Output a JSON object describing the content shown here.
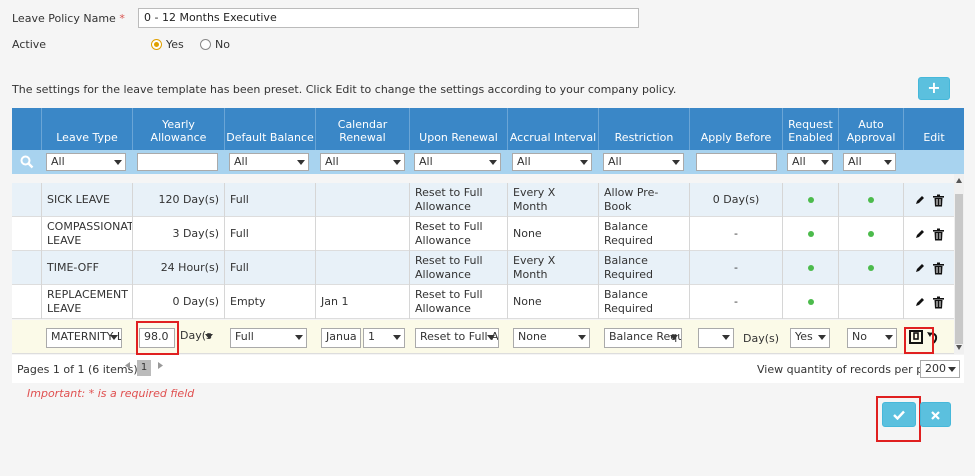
{
  "form": {
    "policy_name_label": "Leave Policy Name",
    "required_mark": "*",
    "policy_name_value": "0 - 12 Months Executive",
    "active_label": "Active",
    "active_yes": "Yes",
    "active_no": "No"
  },
  "notice": "The settings for the leave template has been preset. Click Edit to change the settings according to your company policy.",
  "add_button": "+",
  "table": {
    "headers": [
      "Leave Type",
      "Yearly Allowance",
      "Default Balance",
      "Calendar Renewal",
      "Upon Renewal",
      "Accrual Interval",
      "Restriction",
      "Apply Before",
      "Request Enabled",
      "Auto Approval",
      "Edit"
    ],
    "filter_all": "All",
    "rows": [
      {
        "type": "SICK LEAVE",
        "allowance": "120 Day(s)",
        "balance": "Full",
        "calendar": "",
        "renewal": "Reset to Full Allowance",
        "accrual": "Every X Month",
        "restriction": "Allow Pre-Book",
        "apply_before": "0 Day(s)",
        "request": true,
        "auto": true
      },
      {
        "type": "COMPASSIONATE LEAVE",
        "allowance": "3 Day(s)",
        "balance": "Full",
        "calendar": "",
        "renewal": "Reset to Full Allowance",
        "accrual": "None",
        "restriction": "Balance Required",
        "apply_before": "-",
        "request": true,
        "auto": true
      },
      {
        "type": "TIME-OFF",
        "allowance": "24 Hour(s)",
        "balance": "Full",
        "calendar": "",
        "renewal": "Reset to Full Allowance",
        "accrual": "Every X Month",
        "restriction": "Balance Required",
        "apply_before": "-",
        "request": true,
        "auto": true
      },
      {
        "type": "REPLACEMENT LEAVE",
        "allowance": "0 Day(s)",
        "balance": "Empty",
        "calendar": "Jan 1",
        "renewal": "Reset to Full Allowance",
        "accrual": "None",
        "restriction": "Balance Required",
        "apply_before": "-",
        "request": true,
        "auto": false
      }
    ],
    "edit_row": {
      "type": "MATERNITY L",
      "allowance_value": "98.0",
      "allowance_unit": "Day(s",
      "balance": "Full",
      "calendar_month": "Janua",
      "calendar_day": "1",
      "renewal": "Reset to Full A",
      "accrual": "None",
      "restriction": "Balance Requ",
      "apply_before_unit": "Day(s)",
      "request": "Yes",
      "auto": "No"
    }
  },
  "pager": {
    "summary": "Pages 1 of 1 (6 items)",
    "current_page": "1",
    "per_page_label": "View quantity of records per page",
    "per_page_value": "200"
  },
  "required_note": "Important: * is a required field",
  "actions": {
    "confirm_icon": "check-icon",
    "cancel_icon": "close-icon"
  },
  "colors": {
    "header_blue": "#3a87c7",
    "filter_blue": "#a8d3ef",
    "button_blue": "#5bc0de",
    "highlight_red": "#e02020",
    "dot_green": "#4cbb4c"
  }
}
